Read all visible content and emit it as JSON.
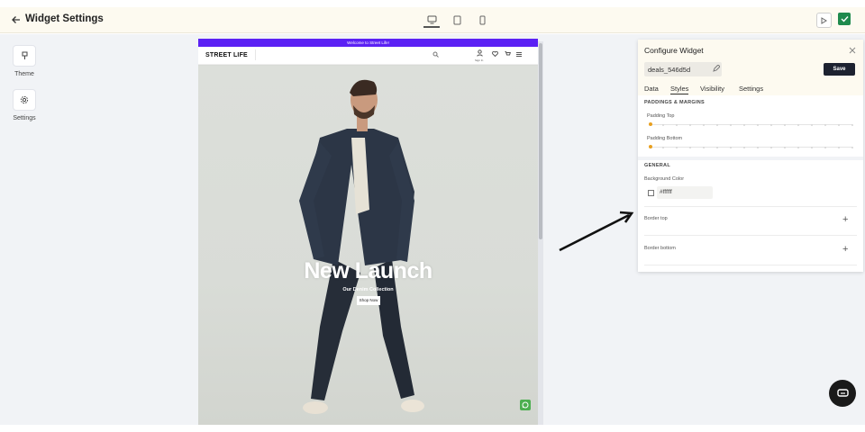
{
  "header": {
    "title": "Widget Settings",
    "devices": [
      "desktop-icon",
      "tablet-icon",
      "mobile-icon"
    ],
    "active_device": "desktop"
  },
  "sidebar": {
    "items": [
      {
        "label": "Theme",
        "icon": "brush-icon"
      },
      {
        "label": "Settings",
        "icon": "gear-icon"
      }
    ]
  },
  "preview": {
    "announcement": "Welcome to Street Life!",
    "logo": "STREET LIFE",
    "signin": "Sign In",
    "hero_title": "New Launch",
    "hero_subtitle": "Our Denim Collection",
    "hero_button": "Shop Now"
  },
  "panel": {
    "title": "Configure Widget",
    "widget_id": "deals_546d5d",
    "save_label": "Save",
    "tabs": [
      "Data",
      "Styles",
      "Visibility",
      "Settings"
    ],
    "active_tab": "Styles",
    "paddings_title": "PADDINGS & MARGINS",
    "padding_top_label": "Padding Top",
    "padding_top_value": 0,
    "padding_bottom_label": "Padding Bottom",
    "padding_bottom_value": 0,
    "general_title": "GENERAL",
    "bg_color_label": "Background Color",
    "bg_color_value": "#ffffff",
    "border_top_label": "Border top",
    "border_bottom_label": "Border bottom"
  },
  "colors": {
    "accent": "#5b21f4",
    "publish": "#1f8a4d",
    "save_button": "#1d2230",
    "slider_knob": "#e8a020"
  }
}
